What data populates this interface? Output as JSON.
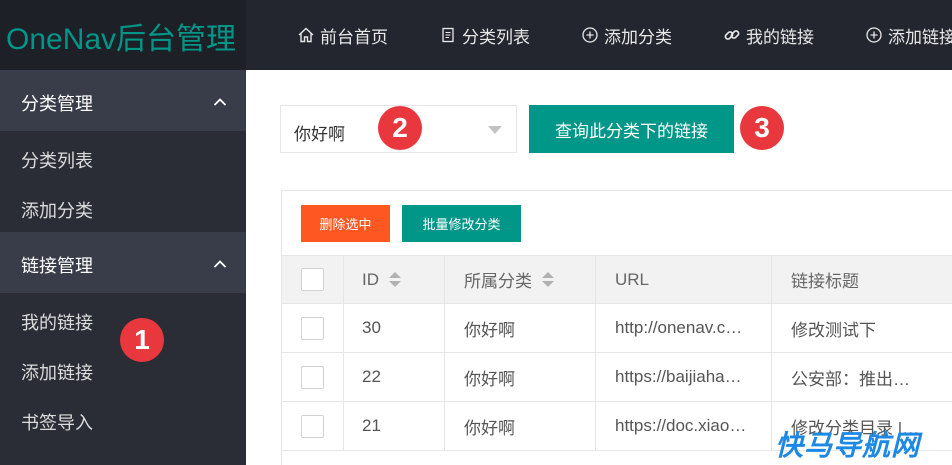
{
  "header": {
    "logo": "OneNav后台管理",
    "nav": [
      {
        "icon": "home-icon",
        "label": "前台首页"
      },
      {
        "icon": "document-icon",
        "label": "分类列表"
      },
      {
        "icon": "plus-circle-icon",
        "label": "添加分类"
      },
      {
        "icon": "link-icon",
        "label": "我的链接"
      },
      {
        "icon": "plus-circle-icon",
        "label": "添加链接"
      }
    ]
  },
  "sidebar": {
    "groups": [
      {
        "label": "分类管理",
        "items": [
          {
            "label": "分类列表"
          },
          {
            "label": "添加分类"
          }
        ]
      },
      {
        "label": "链接管理",
        "items": [
          {
            "label": "我的链接"
          },
          {
            "label": "添加链接"
          },
          {
            "label": "书签导入"
          }
        ]
      }
    ]
  },
  "filter": {
    "select_value": "你好啊",
    "query_button": "查询此分类下的链接"
  },
  "markers": [
    "1",
    "2",
    "3"
  ],
  "toolbar": {
    "delete_label": "删除选中",
    "batch_label": "批量修改分类"
  },
  "table": {
    "columns": [
      "ID",
      "所属分类",
      "URL",
      "链接标题"
    ],
    "rows": [
      {
        "id": "30",
        "category": "你好啊",
        "url": "http://onenav.c…",
        "title": "修改测试下"
      },
      {
        "id": "22",
        "category": "你好啊",
        "url": "https://baijiaha…",
        "title": "公安部：推出…"
      },
      {
        "id": "21",
        "category": "你好啊",
        "url": "https://doc.xiao…",
        "title": "修改分类目录 |…"
      }
    ]
  },
  "watermark": "快马导航网",
  "colors": {
    "accent": "#009688",
    "danger": "#ff5722",
    "marker": "#e8383d",
    "header_bg": "#23262e",
    "sidebar_bg": "#2a2d35"
  }
}
